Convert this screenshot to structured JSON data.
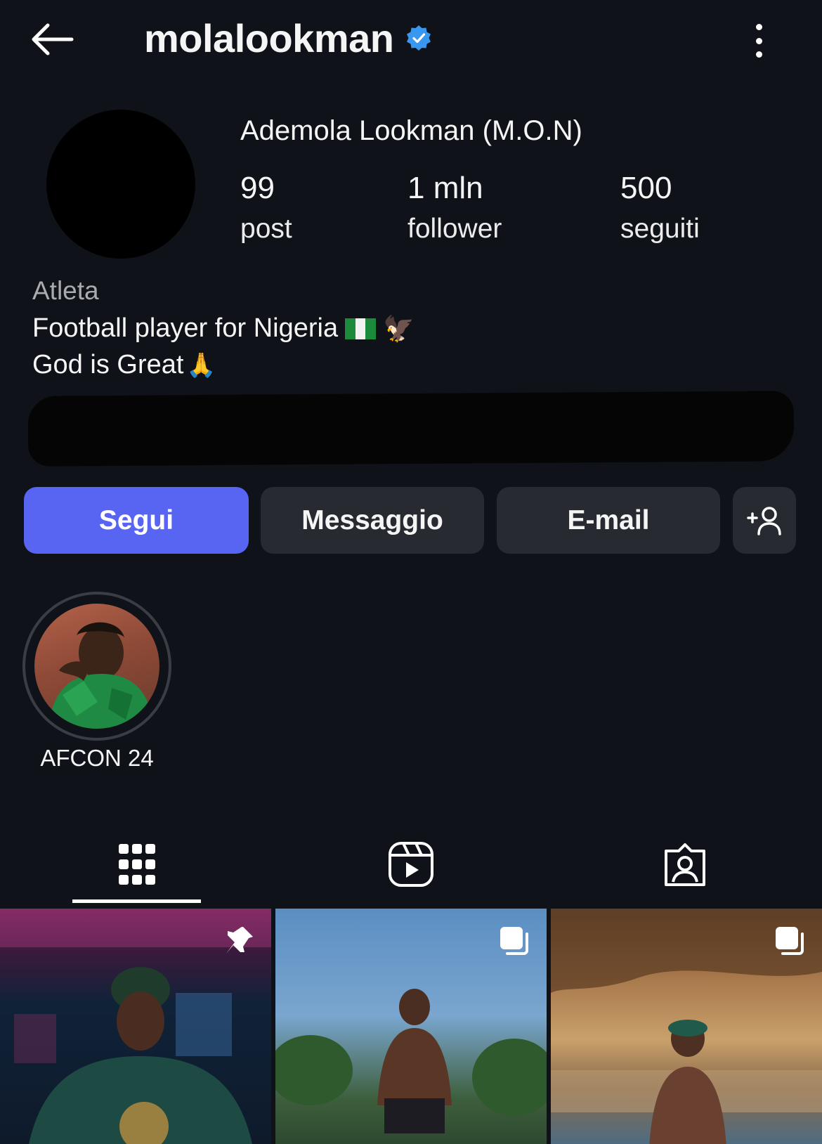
{
  "header": {
    "username": "molalookman",
    "verified": true
  },
  "profile": {
    "display_name": "Ademola Lookman (M.O.N)",
    "stats": [
      {
        "value": "99",
        "label": "post"
      },
      {
        "value": "1 mln",
        "label": "follower"
      },
      {
        "value": "500",
        "label": "seguiti"
      }
    ],
    "category": "Atleta",
    "bio_line1": "Football player for Nigeria",
    "bio_line2": "God is Great",
    "bio_emoji_eagle": "🦅",
    "bio_emoji_pray": "🙏"
  },
  "actions": {
    "follow": "Segui",
    "message": "Messaggio",
    "email": "E-mail",
    "add_user_icon": "person-add-icon"
  },
  "highlights": [
    {
      "label": "AFCON 24"
    }
  ],
  "tabs": [
    {
      "icon": "grid-icon",
      "active": true
    },
    {
      "icon": "reels-icon",
      "active": false
    },
    {
      "icon": "tagged-icon",
      "active": false
    }
  ],
  "posts": [
    {
      "badge": "pin-icon"
    },
    {
      "badge": "carousel-icon"
    },
    {
      "badge": "carousel-icon"
    }
  ],
  "colors": {
    "background": "#0f1218",
    "follow_button": "#5865f2",
    "secondary_button": "#272a31",
    "verified_badge": "#3897f0"
  }
}
